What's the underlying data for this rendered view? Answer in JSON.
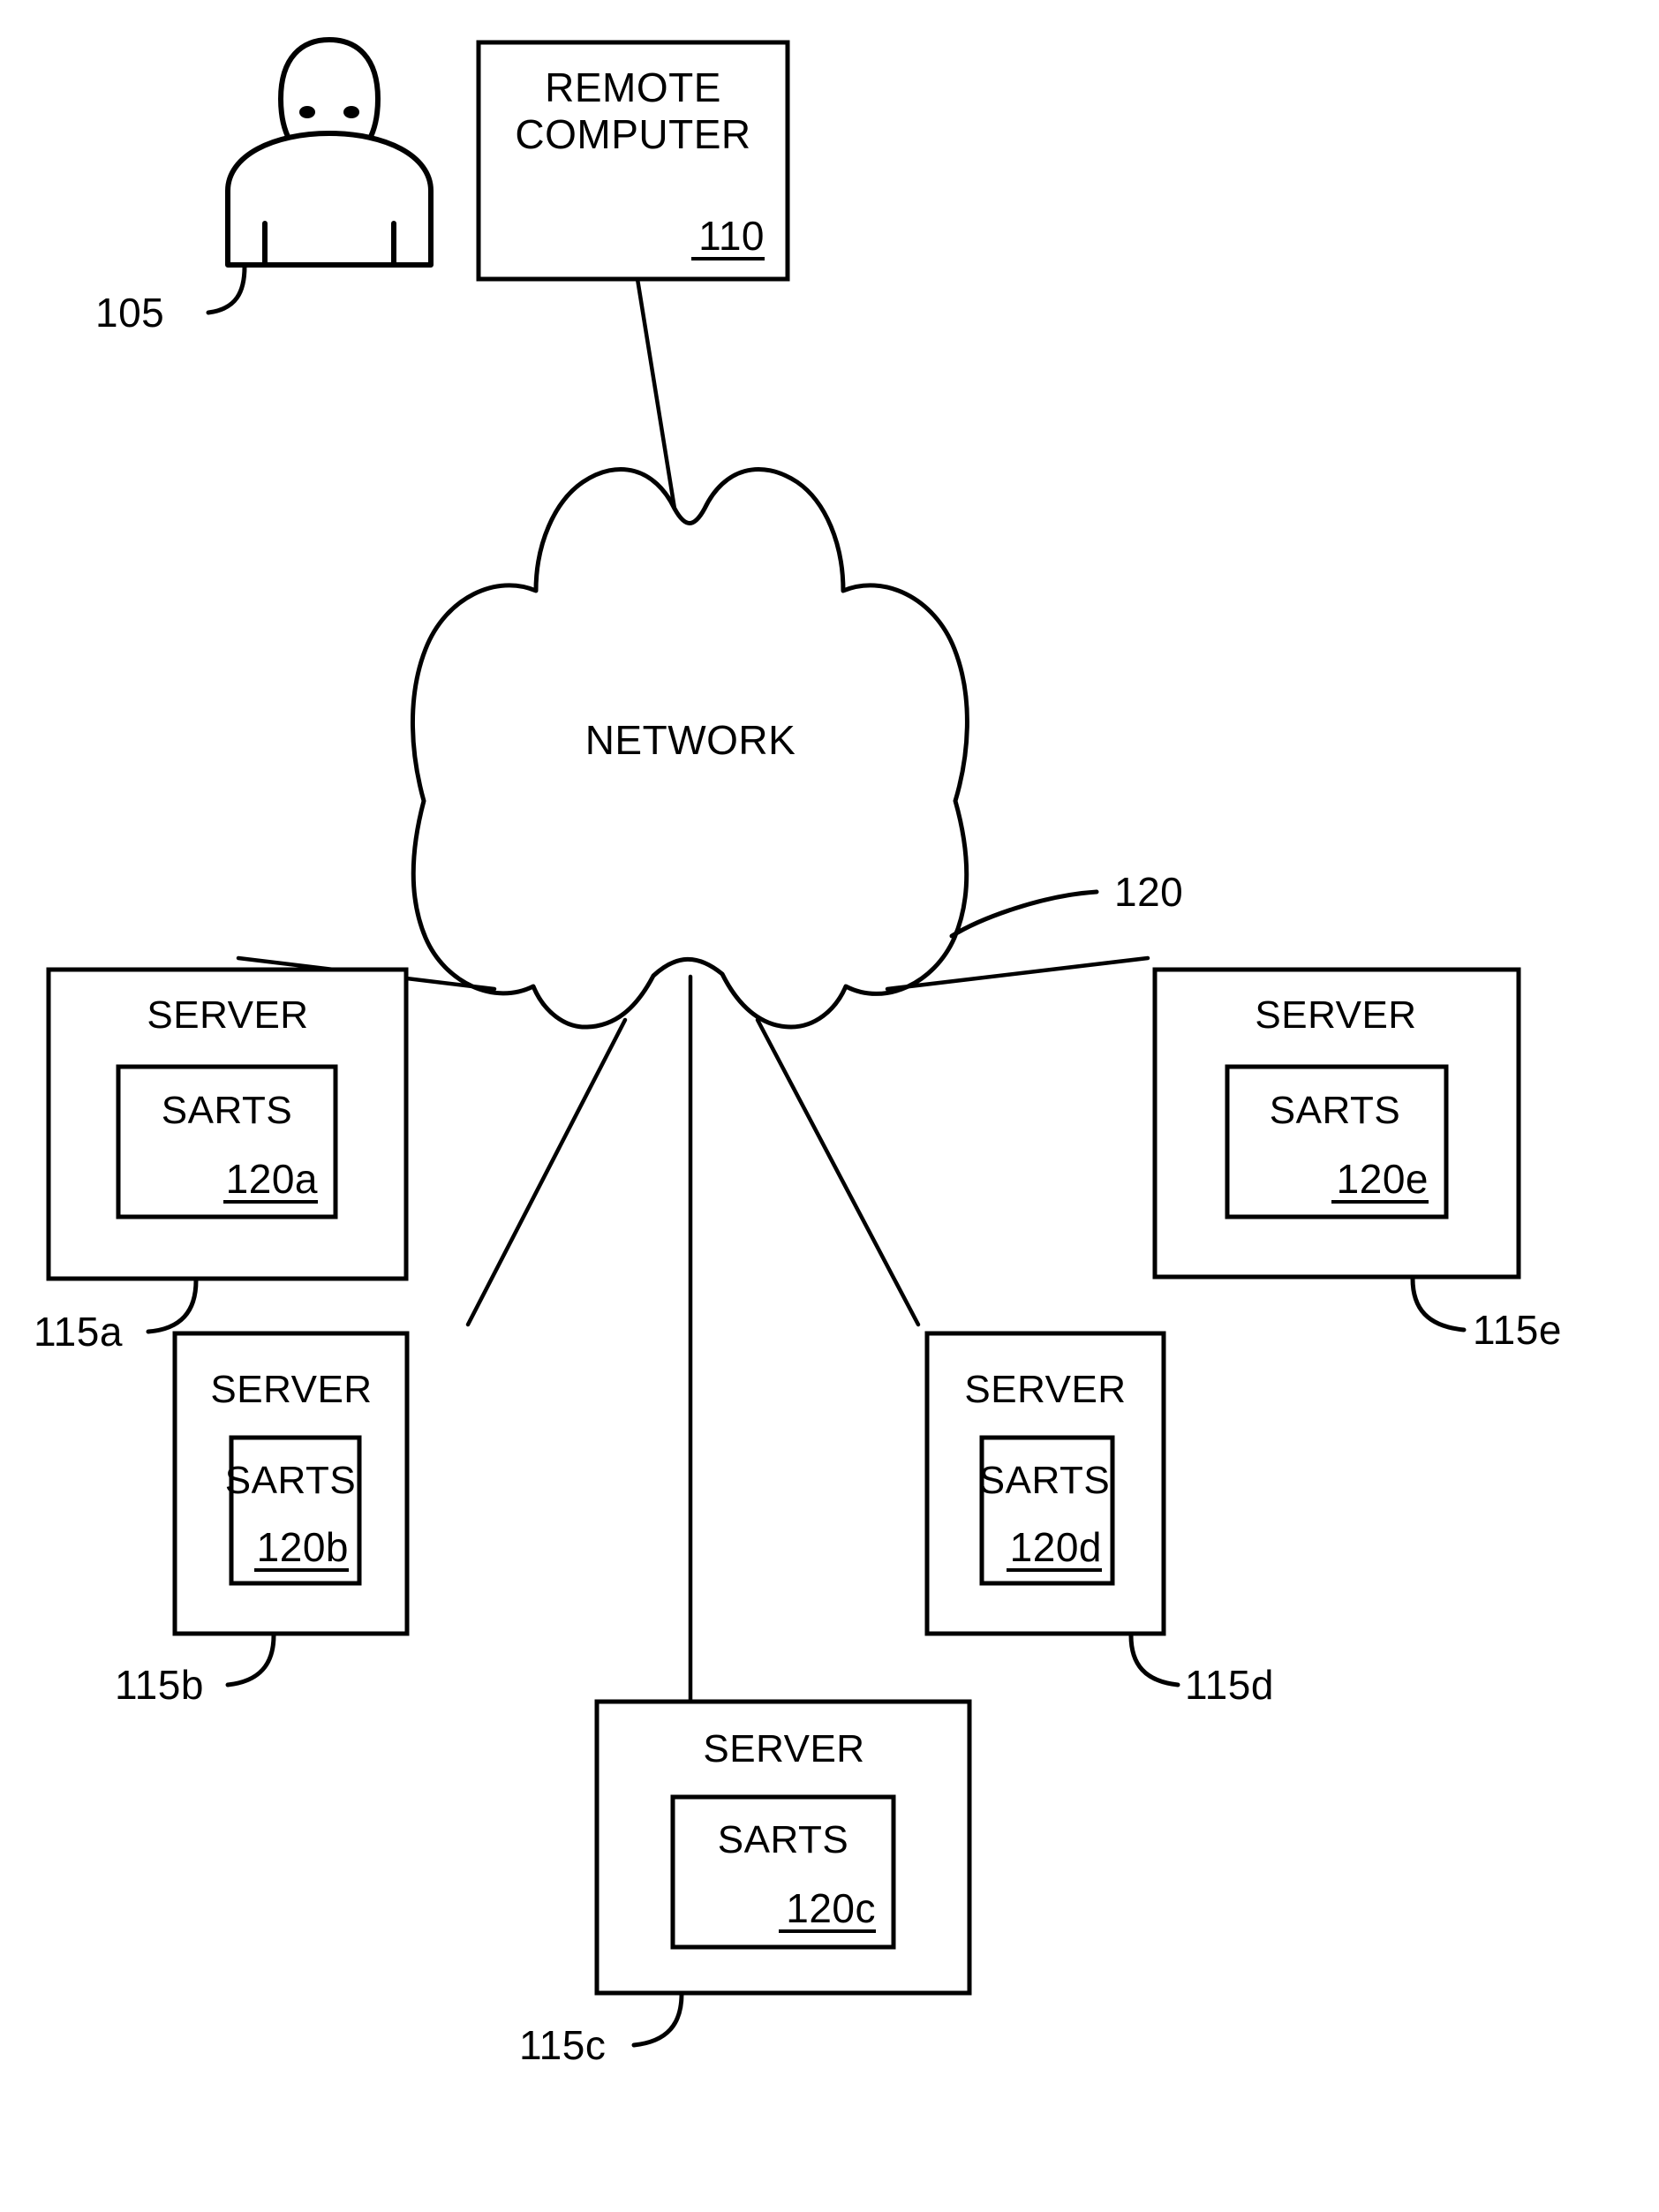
{
  "figure": {
    "type": "patent-network-diagram",
    "background_color": "#ffffff",
    "line_color": "#000000"
  },
  "actor": {
    "icon": "person-icon",
    "ref_label": "105"
  },
  "remote_computer": {
    "line1": "REMOTE",
    "line2": "COMPUTER",
    "ref_label": "110"
  },
  "network": {
    "label": "NETWORK",
    "ref_label": "120"
  },
  "servers": [
    {
      "id": "server-a",
      "title": "SERVER",
      "module_title": "SARTS",
      "module_ref": "120a",
      "ref_label": "115a"
    },
    {
      "id": "server-b",
      "title": "SERVER",
      "module_title": "SARTS",
      "module_ref": "120b",
      "ref_label": "115b"
    },
    {
      "id": "server-c",
      "title": "SERVER",
      "module_title": "SARTS",
      "module_ref": "120c",
      "ref_label": "115c"
    },
    {
      "id": "server-d",
      "title": "SERVER",
      "module_title": "SARTS",
      "module_ref": "120d",
      "ref_label": "115d"
    },
    {
      "id": "server-e",
      "title": "SERVER",
      "module_title": "SARTS",
      "module_ref": "120e",
      "ref_label": "115e"
    }
  ]
}
